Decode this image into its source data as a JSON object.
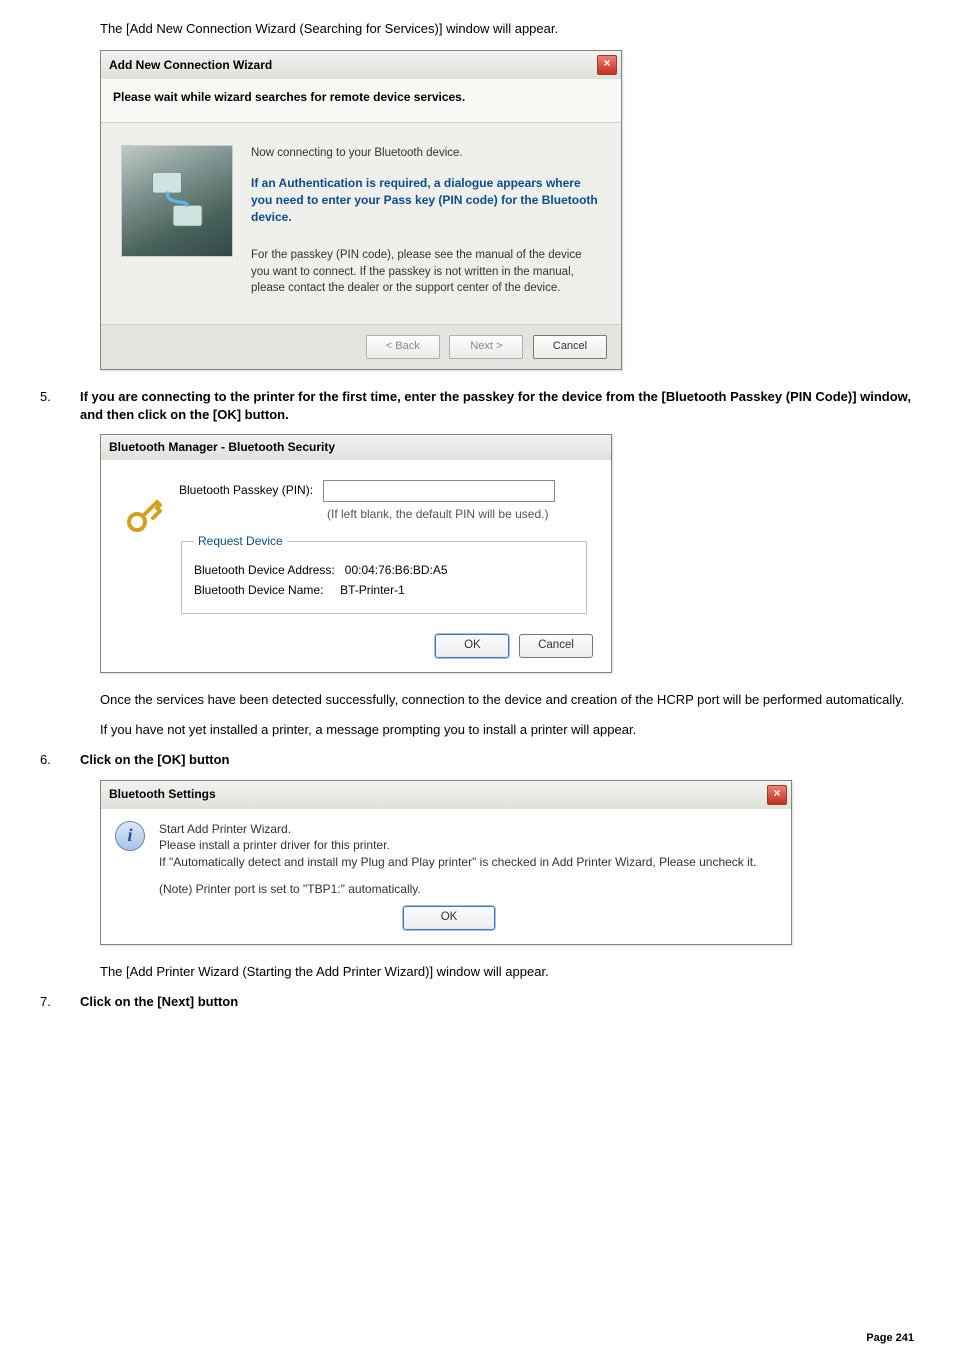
{
  "intro": "The [Add New Connection Wizard (Searching for Services)] window will appear.",
  "wizard": {
    "title": "Add New Connection Wizard",
    "subheading": "Please wait while wizard searches for remote device services.",
    "line1": "Now connecting to your Bluetooth device.",
    "auth_block": "If an Authentication is required, a dialogue appears where you need to enter your Pass key (PIN code) for the Bluetooth device.",
    "note": "For the passkey (PIN code), please see the manual of the device you want to connect. If the passkey is not written in the manual, please contact the dealer or the support center of the device.",
    "buttons": {
      "back": "< Back",
      "next": "Next >",
      "cancel": "Cancel"
    }
  },
  "step5": {
    "num": "5.",
    "title": "If you are connecting to the printer for the first time, enter the passkey for the device from the [Bluetooth Passkey (PIN Code)] window, and then click on the [OK] button."
  },
  "security": {
    "title": "Bluetooth Manager - Bluetooth Security",
    "pin_label": "Bluetooth Passkey (PIN):",
    "hint": "(If left blank, the default PIN will be used.)",
    "legend": "Request Device",
    "addr_label": "Bluetooth Device Address:",
    "addr_value": "00:04:76:B6:BD:A5",
    "name_label": "Bluetooth Device Name:",
    "name_value": "BT-Printer-1",
    "ok": "OK",
    "cancel": "Cancel"
  },
  "post5a": "Once the services have been detected successfully, connection to the device and creation of the HCRP port will be performed automatically.",
  "post5b": "If you have not yet installed a printer, a message prompting you to install a printer will appear.",
  "step6": {
    "num": "6.",
    "title": "Click on the [OK] button"
  },
  "settings": {
    "title": "Bluetooth Settings",
    "line1": "Start Add Printer Wizard.",
    "line2": "Please install a printer driver for this printer.",
    "line3": "If \"Automatically detect and install my Plug and Play printer\" is checked in Add Printer Wizard, Please uncheck it.",
    "line4": "(Note) Printer port is set to \"TBP1:\" automatically.",
    "ok": "OK"
  },
  "post6": "The [Add Printer Wizard (Starting the Add Printer Wizard)] window will appear.",
  "step7": {
    "num": "7.",
    "title": "Click on the [Next] button"
  },
  "page": "Page 241"
}
